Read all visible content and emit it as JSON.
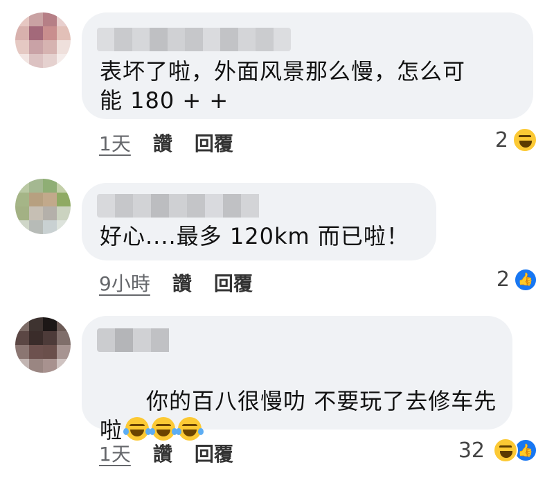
{
  "comments": [
    {
      "text": "表坏了啦，外面风景那么慢，怎么可\n能 180 + +",
      "time": "1天",
      "like_label": "讚",
      "reply_label": "回覆",
      "reaction_count": "2",
      "reaction_icons": [
        "haha-icon"
      ]
    },
    {
      "text": "好心....最多 120km 而已啦！",
      "time": "9小時",
      "like_label": "讚",
      "reply_label": "回覆",
      "reaction_count": "2",
      "reaction_icons": [
        "like-icon"
      ]
    },
    {
      "text": "你的百八很慢叻 不要玩了去修车先\n啦",
      "time": "1天",
      "like_label": "讚",
      "reply_label": "回覆",
      "reaction_count": "32",
      "reaction_icons": [
        "haha-icon",
        "like-icon"
      ],
      "inline_emojis": [
        "tears-of-joy-icon",
        "tears-of-joy-icon",
        "tears-of-joy-icon"
      ]
    }
  ],
  "colors": {
    "bubble": "#f0f2f5",
    "like_blue": "#1877f2",
    "haha_yellow": "#fcc934"
  }
}
